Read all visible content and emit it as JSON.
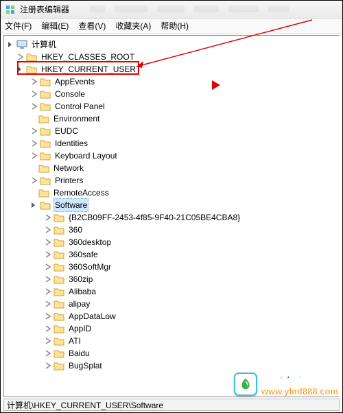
{
  "titlebar": {
    "title": "注册表编辑器"
  },
  "menubar": {
    "file": "文件(F)",
    "edit": "编辑(E)",
    "view": "查看(V)",
    "favorites": "收藏夹(A)",
    "help": "帮助(H)"
  },
  "tree": {
    "root": "计算机",
    "hkcr": "HKEY_CLASSES_ROOT",
    "hkcu": "HKEY_CURRENT_USER",
    "hkcu_children": {
      "appevents": "AppEvents",
      "console": "Console",
      "controlpanel": "Control Panel",
      "environment": "Environment",
      "eudc": "EUDC",
      "identities": "Identities",
      "keyboard": "Keyboard Layout",
      "network": "Network",
      "printers": "Printers",
      "remoteaccess": "RemoteAccess",
      "software": "Software"
    },
    "software_children": {
      "guid": "{B2CB09FF-2453-4f85-9F40-21C05BE4CBA8}",
      "n360": "360",
      "n360desktop": "360desktop",
      "n360safe": "360safe",
      "n360softmgr": "360SoftMgr",
      "n360zip": "360zip",
      "alibaba": "Alibaba",
      "alipay": "alipay",
      "appdatalow": "AppDataLow",
      "appid": "AppID",
      "ati": "ATI",
      "baidu": "Baidu",
      "bugsplat": "BugSplat"
    }
  },
  "statusbar": {
    "path": "计算机\\HKEY_CURRENT_USER\\Software"
  },
  "watermark": {
    "cn": "雨林木风",
    "url": "www.ylmf888.com"
  }
}
